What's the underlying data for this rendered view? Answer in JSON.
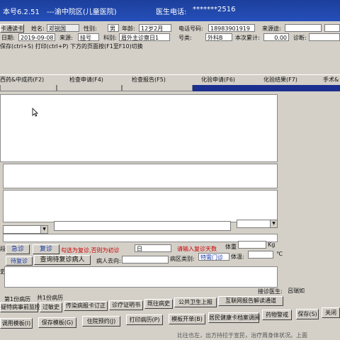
{
  "title": {
    "version": "本号6.2.51",
    "hospital": "---渝中院区(儿童医院)",
    "phone_label": "医生电话:",
    "phone_value": "*******2516"
  },
  "form": {
    "card_label": "卡通读卡",
    "name_label": "姓名:",
    "name_value": "邓锐国",
    "gender_label": "性别:",
    "gender_value": "男",
    "age_label": "年龄:",
    "age_value": "12岁2月",
    "phone_label": "电话号码:",
    "phone_value": "18983901919",
    "visit_label": "来源途:",
    "date_label": "日期:",
    "date_value": "2019-09-08",
    "source_label": "来源:",
    "source_value": "挂号",
    "dept_label": "科别:",
    "dept_value": "眉外主诊察日1",
    "num_label": "号类:",
    "num_value": "外科B",
    "total_label": "本次累计:",
    "total_value": "0.00",
    "diag_label": "诊断:"
  },
  "hint": "保存(ctrl+S)  打印(ctrl+P)    下方的页面按(F1至F10)切换",
  "tabs": [
    "西药&中成药(F2)",
    "检查申请(F4)",
    "检查报告(F5)",
    "化验申请(F6)",
    "化验结果(F7)",
    "手术&"
  ],
  "followup": {
    "urgent": "急诊",
    "recheck": "复诊",
    "notice": "勾选为复诊,否则为初诊",
    "days_value": "日",
    "days_hint": "请输入复诊天数",
    "weight_label": "体重",
    "weight_unit": "Kg",
    "pending": "待复诊",
    "query": "查询待复诊病人",
    "whereabouts_label": "病人去向:",
    "ward_label": "病区类别:",
    "ward_value": "特需门诊",
    "temp_label": "体温:",
    "temp_unit": "℃",
    "left_a": "段",
    "left_b": "史"
  },
  "bottom": {
    "count_a": "第1份病历",
    "count_b": "共1份病历",
    "doctor": "接诊医生:",
    "doctor_value": "吕瑞如",
    "btn_row1": [
      "疑特病事前监控",
      "过敏史",
      "传染病报卡订正",
      "诊疗证明书",
      "既往病史",
      "公共卫生上报",
      "互联网报告解读通道"
    ],
    "btn_row2": [
      "调用模板(I)",
      "保存模板(G)",
      "住院预约(J)",
      "打印病历(P)",
      "模板开单(B)",
      "居民健康卡档案调阅",
      "药物警戒",
      "保存(S)",
      "关闭"
    ],
    "tail": "比往也左，出方持拉于宣民，治疗周身体状况。上面"
  }
}
